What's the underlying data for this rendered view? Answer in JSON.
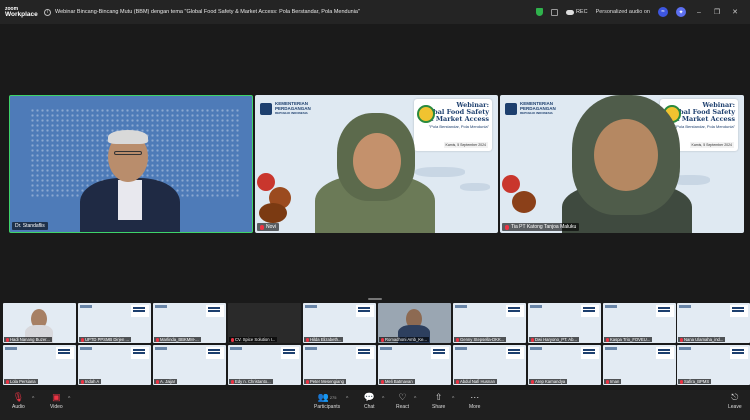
{
  "app": {
    "logo_line1": "zoom",
    "logo_line2": "Workplace"
  },
  "meeting": {
    "title": "Webinar Bincang-Bincang Mutu (BBM) dengan tema \"Global Food Safety & Market Access: Pola Berstandar, Pola Mendunia\"",
    "rec_label": "REC",
    "personalized_audio": "Personalized audio on"
  },
  "speakers": [
    {
      "name": "Dr. Standaflis"
    },
    {
      "name": "Novi"
    },
    {
      "name": "Tia PT Katong Tanjoa Maluku"
    }
  ],
  "slide": {
    "ministry_line1": "KEMENTERIAN",
    "ministry_line2": "PERDAGANGAN",
    "ministry_line3": "REPUBLIK INDONESIA",
    "webinar_title_1": "Webinar:",
    "webinar_title_2": "Global Food Safety",
    "webinar_title_3": "& Market Access",
    "webinar_subtitle": "\"Pola Berstandar, Pola Mendunia\"",
    "date": "Kamis, 5 September 2024"
  },
  "gallery": [
    {
      "name": "Hadi Nanang Buzer..."
    },
    {
      "name": "UPTD PPSMB Dirjen ..."
    },
    {
      "name": "Marlinda_BBKMM-..."
    },
    {
      "name": "CV. Spice Solution I..."
    },
    {
      "name": "Hilda Elizabeth..."
    },
    {
      "name": "Romadhoni Amb_Ke..."
    },
    {
      "name": "Genny Stepsella-DKK..."
    },
    {
      "name": "Dwi Haryono_PT. Ab..."
    },
    {
      "name": "Kaspa Trio_FOVEU..."
    },
    {
      "name": "Nana Ulamaha_ind..."
    },
    {
      "name": "Lola Persiana"
    },
    {
      "name": "Indah A"
    },
    {
      "name": "A. Jaijar"
    },
    {
      "name": "Edy n. Christanto..."
    },
    {
      "name": "Peter Mesengiang"
    },
    {
      "name": "Meli Batmavan"
    },
    {
      "name": "Abdul Nafi Husnan"
    },
    {
      "name": "Arep Karnandya"
    },
    {
      "name": "Iman"
    },
    {
      "name": "Safira_BPMS"
    }
  ],
  "toolbar": {
    "audio": "Audio",
    "video": "Video",
    "participants": "Participants",
    "participants_count": "275",
    "chat": "Chat",
    "react": "React",
    "share": "Share",
    "more": "More",
    "leave": "Leave"
  },
  "colors": {
    "active_speaker": "#3fd46a",
    "accent": "#3d56e0",
    "leave": "#e34444"
  }
}
